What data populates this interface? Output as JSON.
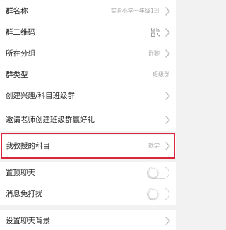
{
  "colors": {
    "background": "#f2f2f2",
    "row_background": "#ffffff",
    "highlight": "#d9273b",
    "secondary_text": "#a9a9a9"
  },
  "settings": {
    "group_name": {
      "label": "群名称",
      "value": "实验小学一年级1班"
    },
    "qr_code": {
      "label": "群二维码",
      "icon": "qr-code-icon"
    },
    "group_category": {
      "label": "所在分组",
      "value": "群聊"
    },
    "group_type": {
      "label": "群类型",
      "value": "班级群"
    },
    "create_interest_group": {
      "label": "创建兴趣/科目班级群"
    },
    "invite_teacher": {
      "label": "邀请老师创建班级群赢好礼"
    },
    "my_subject": {
      "label": "我教授的科目",
      "value": "数学",
      "highlighted": true
    },
    "pin_chat": {
      "label": "置顶聊天",
      "enabled": false
    },
    "mute_notifications": {
      "label": "消息免打扰",
      "enabled": false
    },
    "chat_background": {
      "label": "设置聊天背景"
    }
  }
}
